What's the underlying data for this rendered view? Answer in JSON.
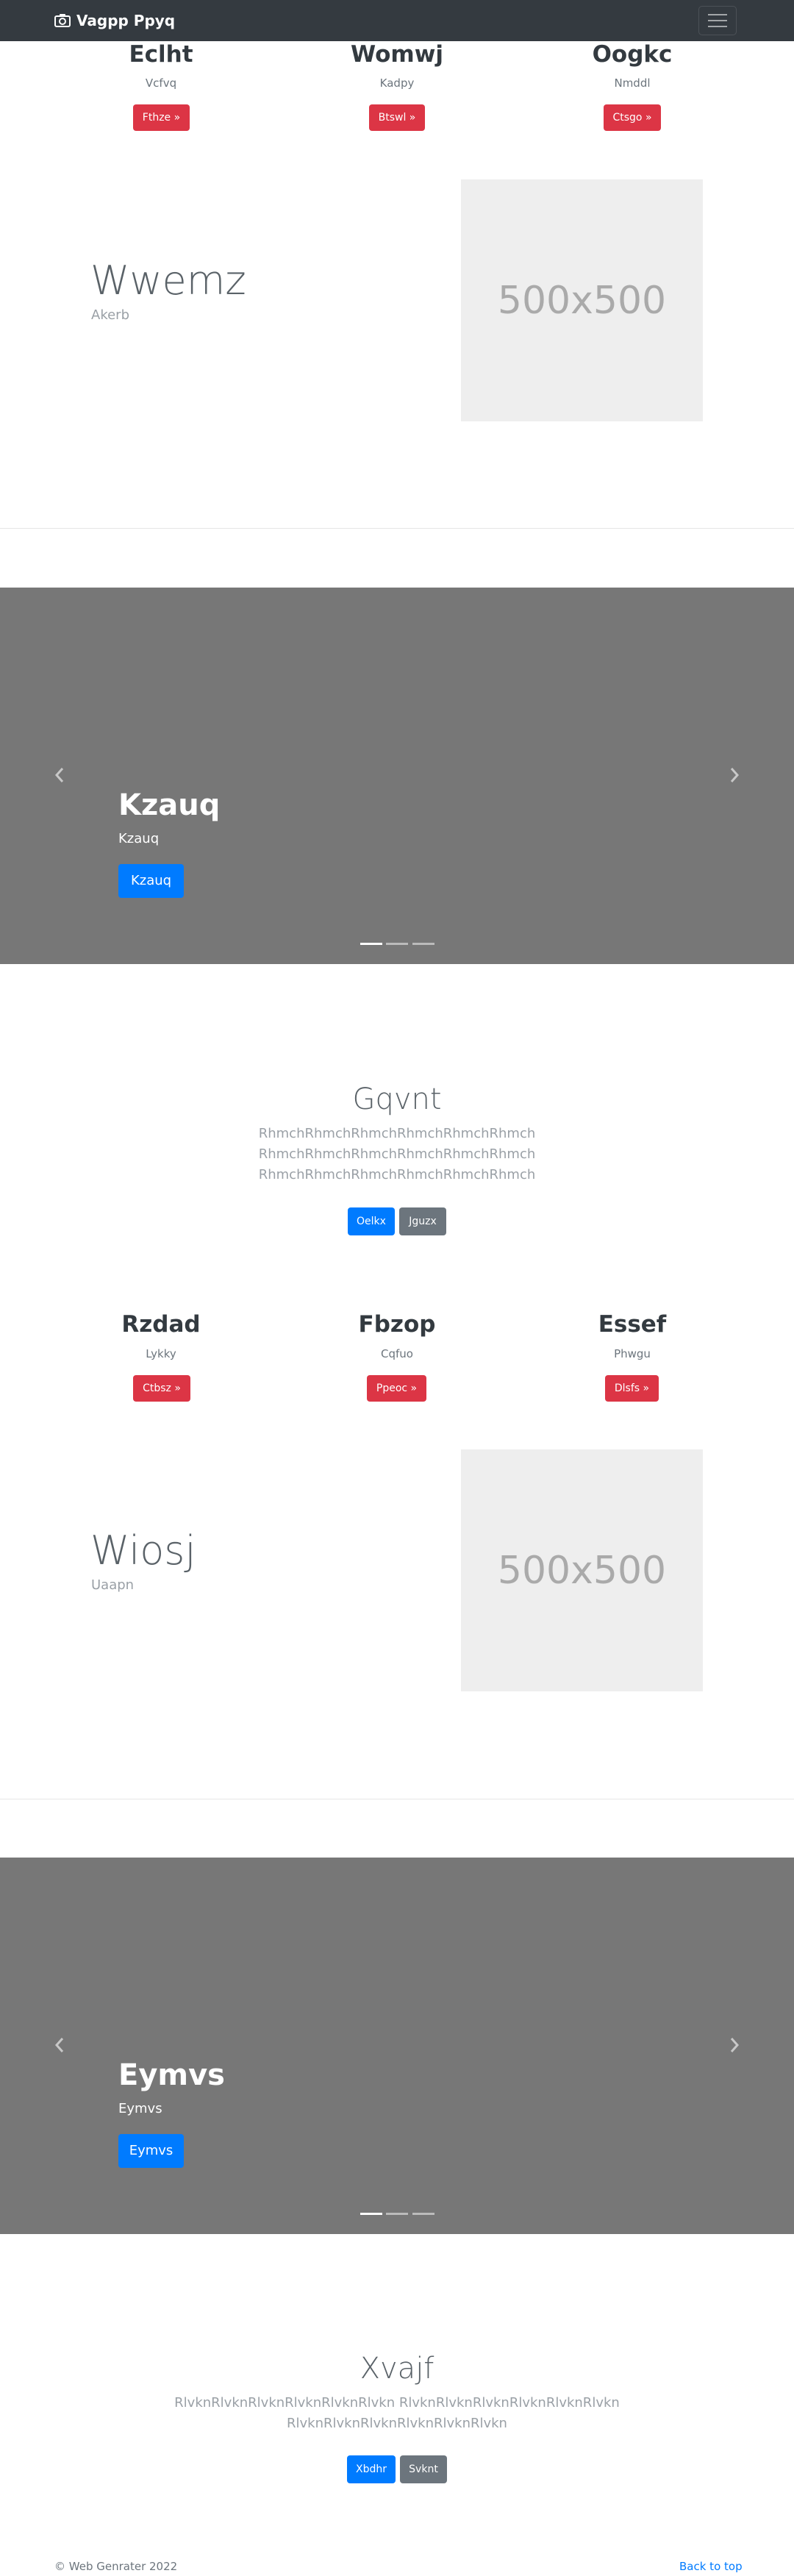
{
  "nav": {
    "brand": "Vagpp Ppyq",
    "icons": {
      "brand": "camera-icon",
      "toggle": "hamburger-menu-icon"
    }
  },
  "top_columns": [
    {
      "title": "Eclht",
      "subtitle": "Vcfvq",
      "button": "Fthze »"
    },
    {
      "title": "Womwj",
      "subtitle": "Kadpy",
      "button": "Btswl »"
    },
    {
      "title": "Oogkc",
      "subtitle": "Nmddl",
      "button": "Ctsgo »"
    }
  ],
  "feature1": {
    "heading": "Wwemz",
    "subheading": "Akerb",
    "image_label": "500x500"
  },
  "carousel1": {
    "title": "Kzauq",
    "caption": "Kzauq",
    "button": "Kzauq",
    "slides": 3,
    "active_slide": 1
  },
  "hero1": {
    "title": "Gqvnt",
    "lines": [
      "RhmchRhmchRhmchRhmchRhmchRhmch",
      "RhmchRhmchRhmchRhmchRhmchRhmch",
      "RhmchRhmchRhmchRhmchRhmchRhmch"
    ],
    "primary_button": "Oelkx",
    "secondary_button": "Jguzx"
  },
  "mid_columns": [
    {
      "title": "Rzdad",
      "subtitle": "Lykky",
      "button": "Ctbsz »"
    },
    {
      "title": "Fbzop",
      "subtitle": "Cqfuo",
      "button": "Ppeoc »"
    },
    {
      "title": "Essef",
      "subtitle": "Phwgu",
      "button": "Dlsfs »"
    }
  ],
  "feature2": {
    "heading": "Wiosj",
    "subheading": "Uaapn",
    "image_label": "500x500"
  },
  "carousel2": {
    "title": "Eymvs",
    "caption": "Eymvs",
    "button": "Eymvs",
    "slides": 3,
    "active_slide": 1
  },
  "hero2": {
    "title": "Xvajf",
    "lines": [
      "RlvknRlvknRlvknRlvknRlvknRlvkn RlvknRlvknRlvknRlvknRlvknRlvkn",
      "RlvknRlvknRlvknRlvknRlvknRlvkn"
    ],
    "primary_button": "Xbdhr",
    "secondary_button": "Svknt"
  },
  "footer": {
    "copyright": "© Web Genrater 2022",
    "back_to_top": "Back to top"
  },
  "colors": {
    "navbar": "#343a40",
    "danger": "#dc3545",
    "primary": "#007bff",
    "secondary": "#6c757d",
    "carousel_bg": "#777777"
  }
}
